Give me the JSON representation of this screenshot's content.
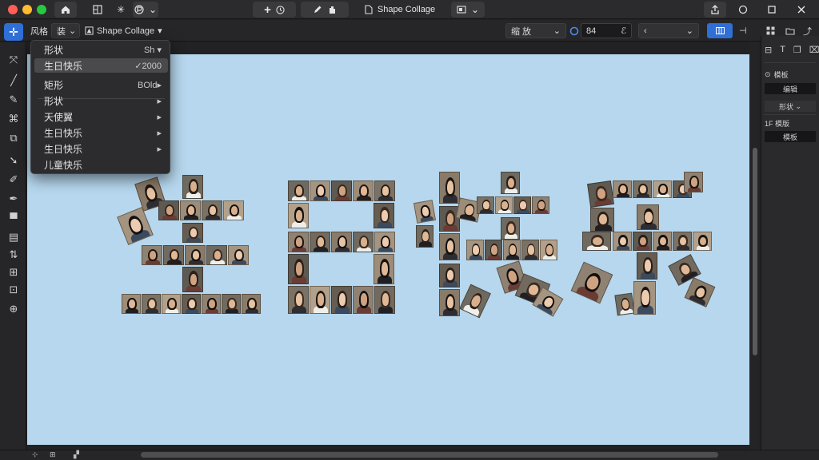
{
  "window": {
    "title": "Shape Collage"
  },
  "titlebar": {
    "home_icon": "home-icon",
    "grid_icon": "layout-icon",
    "asterisk_glyph": "✳",
    "add_icon": "plus-icon",
    "history_icon": "clock-icon",
    "pen_icon": "pen-icon",
    "hand_icon": "hand-icon",
    "doc_icon": "document-icon",
    "view_icon": "view-icon",
    "share_icon": "share-icon",
    "circle_icon": "circle-icon",
    "square_icon": "square-icon",
    "close_icon": "close-icon"
  },
  "options": {
    "mode_label": "风格",
    "style_label": "装",
    "collage_type": "Shape Collage",
    "dropdown_1": "缩 放",
    "value_field": "84",
    "dropdown_2": "‹"
  },
  "menu": {
    "header": {
      "label": "形状",
      "accessory": "Sh"
    },
    "items": [
      {
        "label": "生日快乐",
        "accessory": "✓2000",
        "selected": true
      },
      {
        "label": "矩形",
        "accessory": "BOld▸",
        "selected": false
      },
      {
        "label": "形状",
        "accessory": "▸",
        "selected": false
      },
      {
        "label": "天使翼",
        "accessory": "▸",
        "selected": false
      },
      {
        "label": "生日快乐",
        "accessory": "▸",
        "selected": false
      },
      {
        "label": "生日快乐",
        "accessory": "▸",
        "selected": false
      },
      {
        "label": "儿童快乐",
        "accessory": "",
        "selected": false
      }
    ]
  },
  "right_panel": {
    "icons": [
      "crop-icon",
      "text-icon",
      "copy-icon",
      "trash-icon"
    ],
    "section1_label": "模板",
    "field1": "编辑",
    "dropdown": "形状",
    "section2_label": "1F 模版",
    "field2": "模板"
  },
  "canvas": {
    "background": "#b6d7ee",
    "collage_text": "生日快乐"
  }
}
